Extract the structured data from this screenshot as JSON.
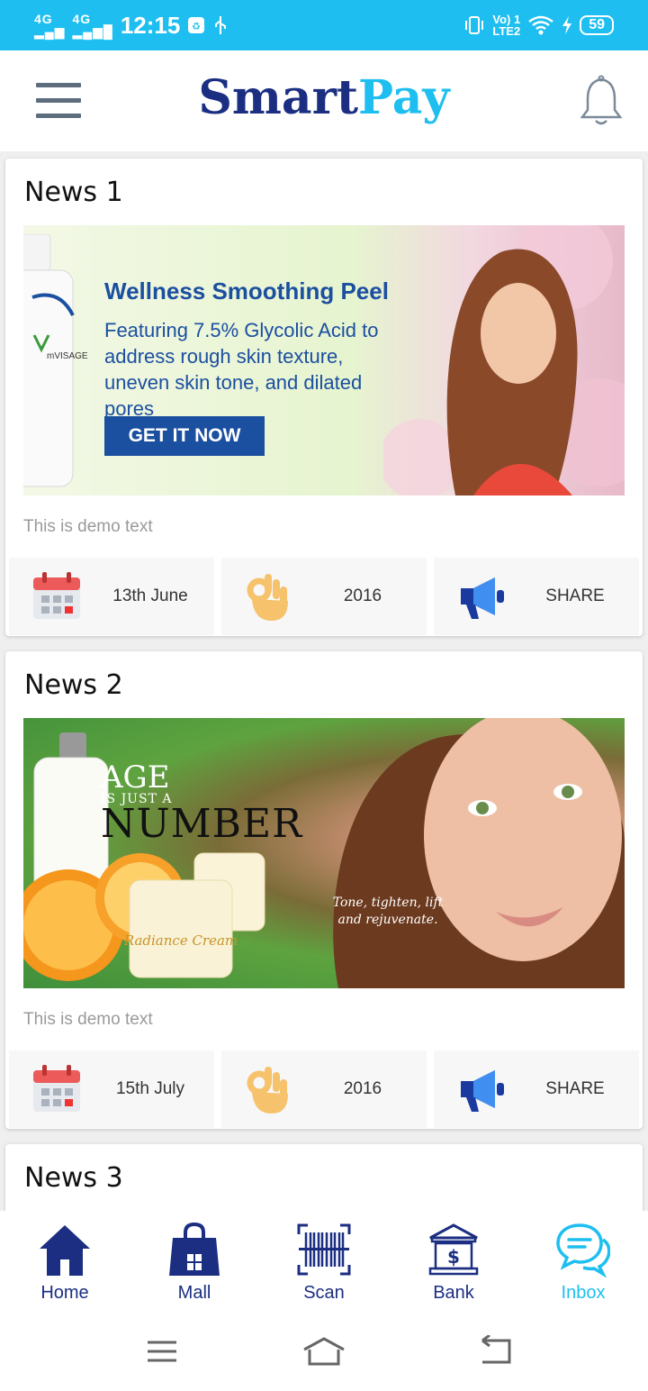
{
  "status_bar": {
    "network1": "4G",
    "network2": "4G",
    "time": "12:15",
    "carrier": "Vo) 1",
    "lte": "LTE2",
    "battery": "59"
  },
  "header": {
    "logo_part1": "Smart",
    "logo_part2": "Pay"
  },
  "news": [
    {
      "title": "News 1",
      "text": "This is demo text",
      "date": "13th June",
      "year": "2016",
      "share": "SHARE",
      "banner": {
        "headline": "Wellness Smoothing Peel",
        "body": "Featuring 7.5% Glycolic Acid to address rough skin texture, uneven skin tone, and dilated pores",
        "cta": "GET IT NOW",
        "brand": "mVISAGE"
      }
    },
    {
      "title": "News 2",
      "text": "This is demo text",
      "date": "15th July",
      "year": "2016",
      "share": "SHARE",
      "banner": {
        "line1": "AGE",
        "line2": "IS JUST A",
        "line3": "NUMBER",
        "tagline": "Tone, tighten, lift and rejuvenate.",
        "product": "Radiance Cream"
      }
    },
    {
      "title": "News 3"
    }
  ],
  "bottom_nav": [
    {
      "label": "Home",
      "icon": "home-icon"
    },
    {
      "label": "Mall",
      "icon": "shopping-bag-icon"
    },
    {
      "label": "Scan",
      "icon": "barcode-scan-icon"
    },
    {
      "label": "Bank",
      "icon": "bank-icon"
    },
    {
      "label": "Inbox",
      "icon": "chat-bubbles-icon",
      "active": true
    }
  ],
  "colors": {
    "brand_dark": "#1b2e82",
    "brand_light": "#1ebff0",
    "status_bar": "#1ebff0"
  }
}
